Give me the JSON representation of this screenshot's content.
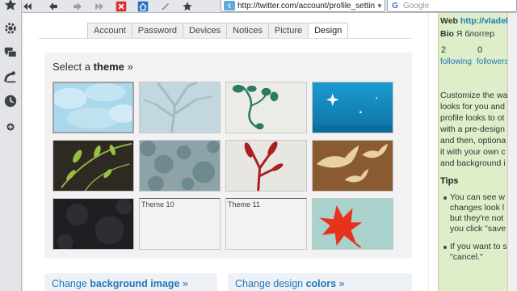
{
  "browser": {
    "url": "http://twitter.com/account/profile_settings",
    "url_favicon": "t",
    "search_engine": "G",
    "search_placeholder": "Google"
  },
  "tabs": [
    {
      "label": "Account",
      "active": false
    },
    {
      "label": "Password",
      "active": false
    },
    {
      "label": "Devices",
      "active": false
    },
    {
      "label": "Notices",
      "active": false
    },
    {
      "label": "Picture",
      "active": false
    },
    {
      "label": "Design",
      "active": true
    }
  ],
  "theme_section": {
    "prefix": "Select a ",
    "bold": "theme",
    "suffix": " »",
    "selected": 1
  },
  "theme_labels": {
    "t10": "Theme 10",
    "t11": "Theme 11"
  },
  "buttons": {
    "bg_prefix": "Change ",
    "bg_bold": "background image",
    "bg_suffix": " »",
    "colors_prefix": "Change design ",
    "colors_bold": "colors",
    "colors_suffix": " »"
  },
  "sidebar": {
    "web_label": "Web",
    "web_link": "http://vladek",
    "bio_label": "Bio",
    "bio_text": "Я блоггер",
    "following_count": "2",
    "followers_count": "0",
    "following_label": "following",
    "followers_label": "followers",
    "desc_lines": [
      "Customize the wa",
      "looks for you and",
      "profile looks to ot",
      "with a pre-design",
      "and then, optiona",
      "it with your own c",
      "and background i"
    ],
    "tips_title": "Tips",
    "tip1_lines": [
      "You can see w",
      "changes look l",
      "but they're not",
      "you click \"save"
    ],
    "tip2_lines": [
      "If you want to s",
      "\"cancel.\""
    ]
  },
  "colors": {
    "link": "#2277bb",
    "sidebar_bg": "#ddeec8",
    "sidebar_border": "#b9d39a"
  }
}
